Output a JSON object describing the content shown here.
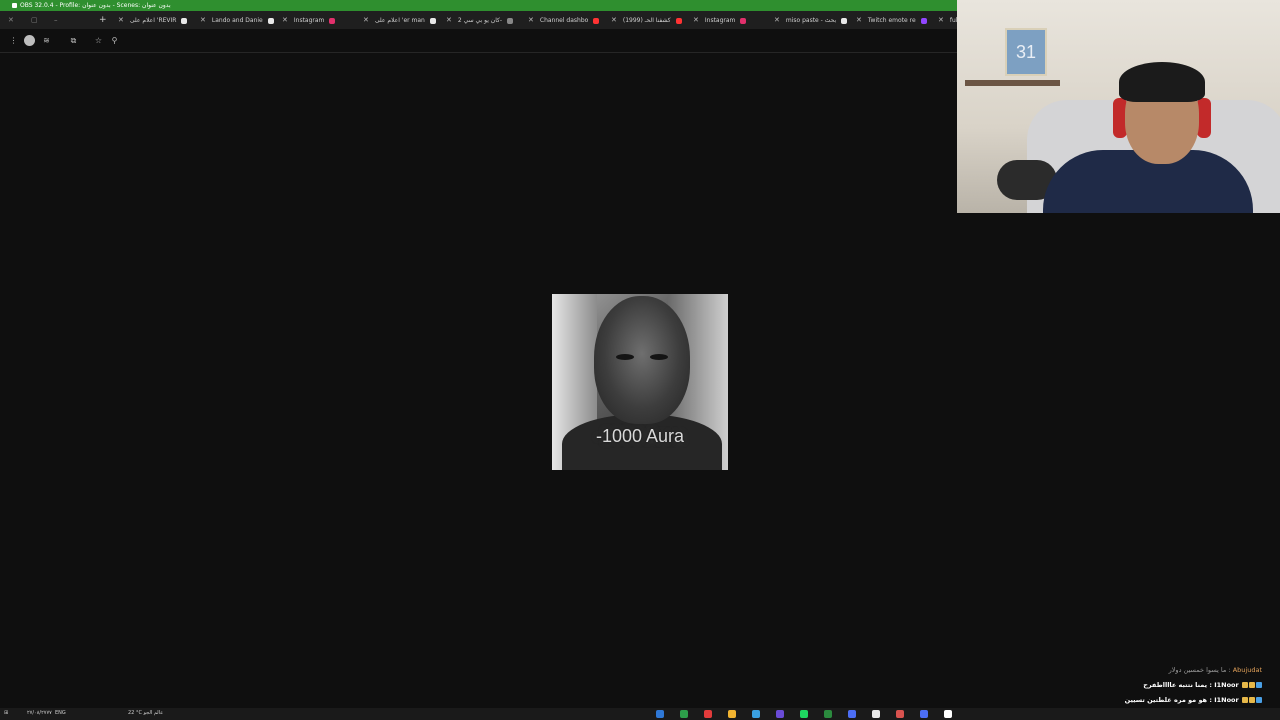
{
  "obs": {
    "title": "OBS 32.0.4 - Profile: بدون عنوان - Scenes: بدون عنوان"
  },
  "tabs": [
    {
      "label": "اعلام على 'REVIR",
      "favicon": "tiktok-icon",
      "color": "#e8e8e8"
    },
    {
      "label": "Lando and Danie",
      "favicon": "tiktok-icon",
      "color": "#e8e8e8"
    },
    {
      "label": "Instagram",
      "favicon": "instagram-icon",
      "color": "#e1306c"
    },
    {
      "label": "اعلام على 'er man",
      "favicon": "tiktok-icon",
      "color": "#e8e8e8"
    },
    {
      "label": "كان يو بي سي 2-",
      "favicon": "globe-icon",
      "color": "#888888"
    },
    {
      "label": "Channel dashbo",
      "favicon": "youtube-icon",
      "color": "#ff3333"
    },
    {
      "label": "كشفنا الحـ (1999)",
      "favicon": "youtube-icon",
      "color": "#ff3333"
    },
    {
      "label": "Instagram",
      "favicon": "instagram-icon",
      "color": "#e1306c"
    },
    {
      "label": "miso paste - بحث",
      "favicon": "google-icon",
      "color": "#e8e8e8"
    },
    {
      "label": "Twitch emote re",
      "favicon": "twitch-icon",
      "color": "#9146ff"
    },
    {
      "label": "full",
      "favicon": "",
      "color": "#e8e8e8"
    }
  ],
  "meme": {
    "caption": "-1000 Aura"
  },
  "webcam": {
    "poster_number": "31"
  },
  "chat": {
    "messages": [
      {
        "user": "Abujudat",
        "text": "ما يسوا خمسين دولار :"
      },
      {
        "user": "I1Noor",
        "text": "يمنا نتتبه عااااطفرح"
      },
      {
        "user": "I1Noor",
        "text": "هو مو مره غلطتين تسيين"
      }
    ]
  },
  "taskbar": {
    "date": "٢٧/٠٨/٢٧٧٧",
    "lang": "ENG",
    "weather": "22 °C عالم الجو"
  }
}
